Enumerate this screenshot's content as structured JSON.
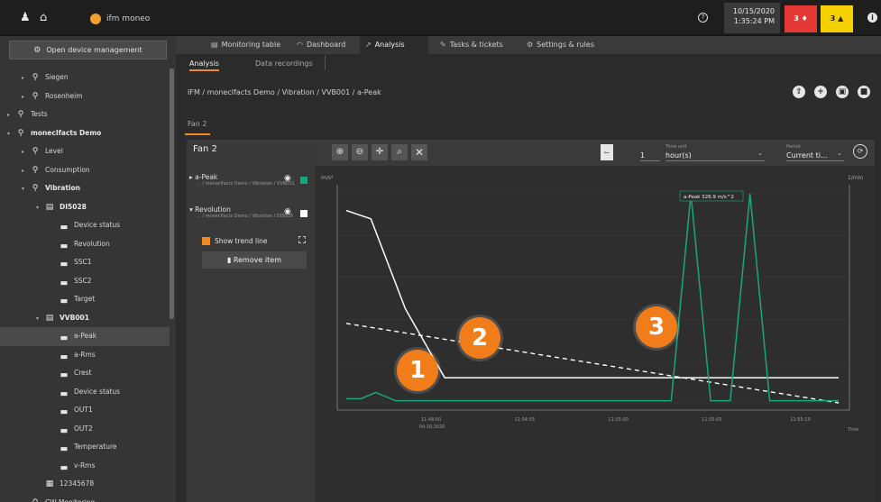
{
  "topbar": {
    "brand": "ifm moneo",
    "help": "?",
    "date": "10/15/2020",
    "time": "1:35:24 PM",
    "alarm_red": "3",
    "alarm_yellow": "3",
    "info": "i"
  },
  "sidebar": {
    "open_button": "Open device management",
    "items": [
      {
        "label": "Siegen",
        "level": 1,
        "type": "location",
        "arrow": "▸"
      },
      {
        "label": "Rosenheim",
        "level": 1,
        "type": "location",
        "arrow": "▸"
      },
      {
        "label": "Tests",
        "level": 0,
        "type": "location",
        "arrow": "▸"
      },
      {
        "label": "monecIfacts Demo",
        "level": 0,
        "type": "location",
        "arrow": "▾",
        "bold": true
      },
      {
        "label": "Level",
        "level": 1,
        "type": "location",
        "arrow": "▸"
      },
      {
        "label": "Consumption",
        "level": 1,
        "type": "location",
        "arrow": "▸"
      },
      {
        "label": "Vibration",
        "level": 1,
        "type": "location",
        "arrow": "▾",
        "bold": true
      },
      {
        "label": "DI5028",
        "level": 2,
        "type": "device",
        "arrow": "▾",
        "bold": true
      },
      {
        "label": "Device status",
        "level": 3,
        "type": "signal"
      },
      {
        "label": "Revolution",
        "level": 3,
        "type": "signal"
      },
      {
        "label": "SSC1",
        "level": 3,
        "type": "signal"
      },
      {
        "label": "SSC2",
        "level": 3,
        "type": "signal"
      },
      {
        "label": "Target",
        "level": 3,
        "type": "signal"
      },
      {
        "label": "VVB001",
        "level": 2,
        "type": "device",
        "arrow": "▾",
        "bold": true
      },
      {
        "label": "a-Peak",
        "level": 3,
        "type": "signal",
        "selected": true
      },
      {
        "label": "a-Rms",
        "level": 3,
        "type": "signal"
      },
      {
        "label": "Crest",
        "level": 3,
        "type": "signal"
      },
      {
        "label": "Device status",
        "level": 3,
        "type": "signal"
      },
      {
        "label": "OUT1",
        "level": 3,
        "type": "signal"
      },
      {
        "label": "OUT2",
        "level": 3,
        "type": "signal"
      },
      {
        "label": "Temperature",
        "level": 3,
        "type": "signal"
      },
      {
        "label": "v-Rms",
        "level": 3,
        "type": "signal"
      },
      {
        "label": "12345678",
        "level": 2,
        "type": "box"
      },
      {
        "label": "CW Monitoring",
        "level": 1,
        "type": "location",
        "arrow": "▸"
      }
    ]
  },
  "nav": {
    "tabs": [
      {
        "label": "Monitoring table",
        "icon": "▤"
      },
      {
        "label": "Dashboard",
        "icon": "◠"
      },
      {
        "label": "Analysis",
        "icon": "↗",
        "active": true
      },
      {
        "label": "Tasks & tickets",
        "icon": "✎"
      },
      {
        "label": "Settings & rules",
        "icon": "⚙"
      }
    ],
    "sub_tabs": [
      "Analysis",
      "Data recordings"
    ]
  },
  "breadcrumb": "IFM / monecIfacts Demo / Vibration / VVB001 / a-Peak",
  "header_tools": [
    "⇧",
    "+",
    "▣",
    "■"
  ],
  "fan_tab": "Fan 2",
  "panel": {
    "title": "Fan 2",
    "series": [
      {
        "label": "a-Peak",
        "path": "... / monecIfacts Demo / Vibration / VVB001",
        "color": "#18a77c"
      },
      {
        "label": "Revolution",
        "path": "... / monecIfacts Demo / Vibration / DI5028",
        "color": "#ffffff"
      }
    ],
    "trend_label": "Show trend line",
    "remove_label": "Remove item"
  },
  "toolbar": {
    "icons": [
      "⊕",
      "⊖",
      "✛",
      "⌕",
      "✕"
    ],
    "count": "1",
    "time_unit_label": "Time unit",
    "time_unit": "hour(s)",
    "period_label": "Period",
    "period": "Current ti..."
  },
  "badges": [
    "1",
    "2",
    "3"
  ],
  "chart_data": {
    "type": "line",
    "y_left_label": "m/s²",
    "y_right_label": "1/min",
    "x_tick_labels": [
      "11:48:00",
      "11:54:55",
      "11:55:00",
      "11:55:05",
      "11:55:10"
    ],
    "x_sub_label": "04.10.2020",
    "right_axis_label": "Time",
    "annotation": "a-Peak 326.9 m/s^2",
    "series": [
      {
        "name": "Revolution",
        "color": "#ffffff",
        "style": "solid",
        "x": [
          0,
          0.05,
          0.12,
          0.2,
          0.3,
          0.45,
          0.6,
          0.8,
          1.0
        ],
        "y": [
          0.92,
          0.88,
          0.45,
          0.12,
          0.12,
          0.12,
          0.12,
          0.12,
          0.12
        ]
      },
      {
        "name": "Revolution trend",
        "color": "#ffffff",
        "style": "dashed",
        "x": [
          0,
          1.0
        ],
        "y": [
          0.38,
          0.0
        ]
      },
      {
        "name": "a-Peak",
        "color": "#18a77c",
        "style": "solid",
        "x": [
          0,
          0.03,
          0.06,
          0.1,
          0.3,
          0.5,
          0.63,
          0.66,
          0.7,
          0.74,
          0.78,
          0.82,
          0.86,
          0.9,
          0.93,
          0.97,
          1.0
        ],
        "y": [
          0.02,
          0.02,
          0.05,
          0.01,
          0.01,
          0.01,
          0.01,
          0.01,
          1.0,
          0.01,
          0.01,
          1.0,
          0.01,
          0.01,
          0.01,
          0.01,
          0.01
        ]
      }
    ],
    "ylim": [
      0,
      1
    ]
  }
}
